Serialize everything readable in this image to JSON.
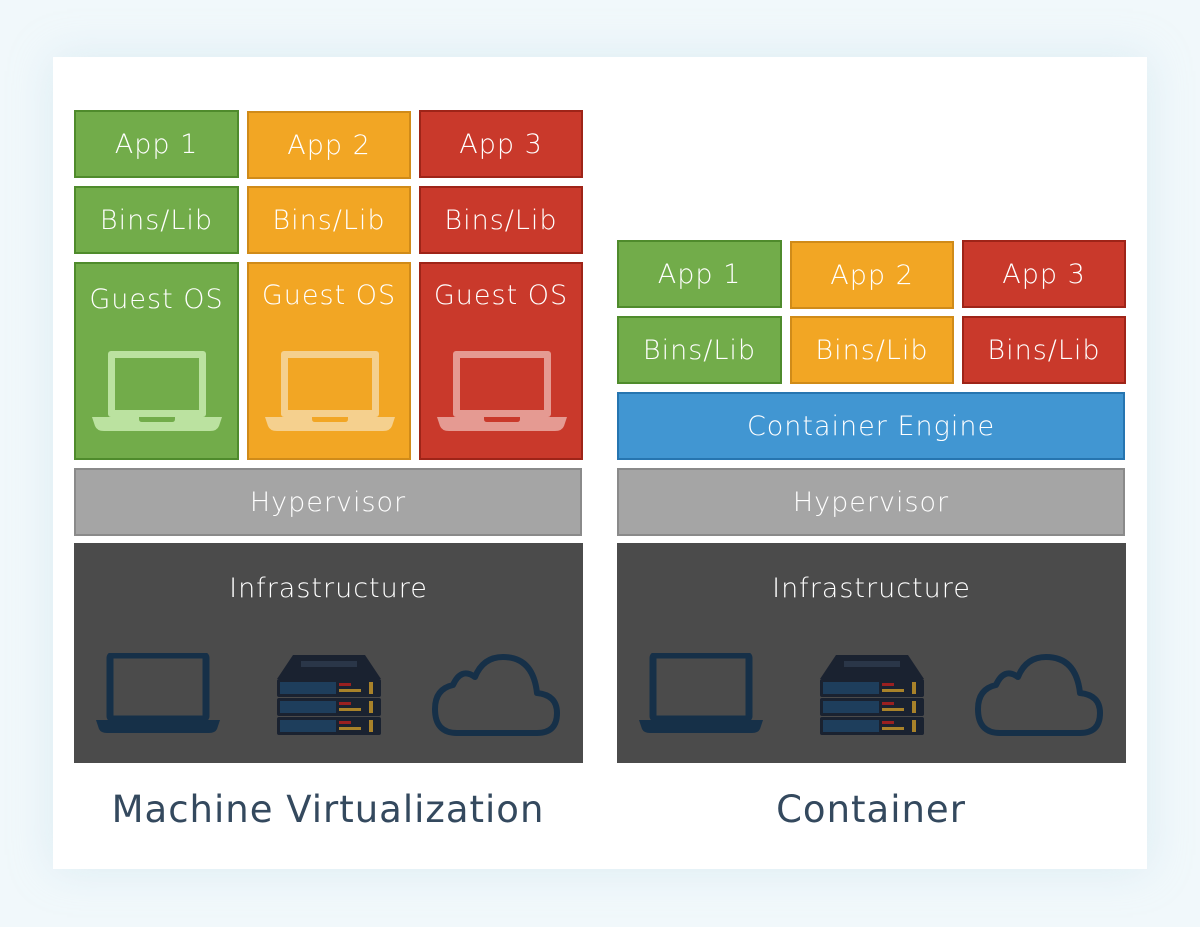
{
  "diagrams": [
    {
      "caption": "Machine Virtualization",
      "columns": [
        {
          "app": "App 1",
          "bins": "Bins/Lib",
          "os": "Guest OS",
          "color": "#72ac4a"
        },
        {
          "app": "App 2",
          "bins": "Bins/Lib",
          "os": "Guest OS",
          "color": "#f2a624"
        },
        {
          "app": "App 3",
          "bins": "Bins/Lib",
          "os": "Guest OS",
          "color": "#c9392b"
        }
      ],
      "hypervisor": "Hypervisor",
      "infrastructure": "Infrastructure",
      "infra_icons": [
        "laptop-icon",
        "server-rack-icon",
        "cloud-icon"
      ]
    },
    {
      "caption": "Container",
      "columns": [
        {
          "app": "App 1",
          "bins": "Bins/Lib",
          "color": "#72ac4a"
        },
        {
          "app": "App 2",
          "bins": "Bins/Lib",
          "color": "#f2a624"
        },
        {
          "app": "App 3",
          "bins": "Bins/Lib",
          "color": "#c9392b"
        }
      ],
      "engine": "Container Engine",
      "engine_color": "#4196d2",
      "hypervisor": "Hypervisor",
      "infrastructure": "Infrastructure",
      "infra_icons": [
        "laptop-icon",
        "server-rack-icon",
        "cloud-icon"
      ]
    }
  ]
}
